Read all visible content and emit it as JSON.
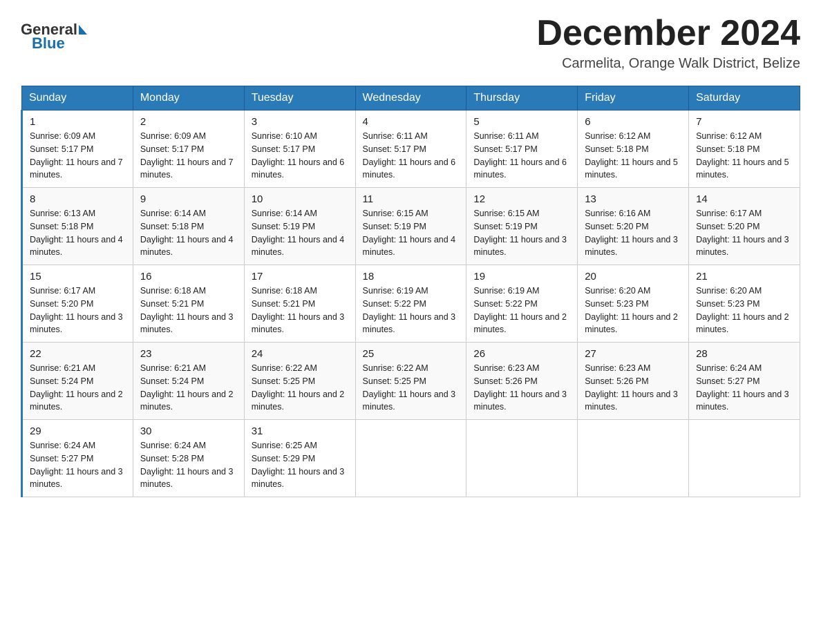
{
  "logo": {
    "general": "General",
    "blue": "Blue"
  },
  "title": "December 2024",
  "location": "Carmelita, Orange Walk District, Belize",
  "days_of_week": [
    "Sunday",
    "Monday",
    "Tuesday",
    "Wednesday",
    "Thursday",
    "Friday",
    "Saturday"
  ],
  "weeks": [
    [
      {
        "day": "1",
        "sunrise": "6:09 AM",
        "sunset": "5:17 PM",
        "daylight": "11 hours and 7 minutes."
      },
      {
        "day": "2",
        "sunrise": "6:09 AM",
        "sunset": "5:17 PM",
        "daylight": "11 hours and 7 minutes."
      },
      {
        "day": "3",
        "sunrise": "6:10 AM",
        "sunset": "5:17 PM",
        "daylight": "11 hours and 6 minutes."
      },
      {
        "day": "4",
        "sunrise": "6:11 AM",
        "sunset": "5:17 PM",
        "daylight": "11 hours and 6 minutes."
      },
      {
        "day": "5",
        "sunrise": "6:11 AM",
        "sunset": "5:17 PM",
        "daylight": "11 hours and 6 minutes."
      },
      {
        "day": "6",
        "sunrise": "6:12 AM",
        "sunset": "5:18 PM",
        "daylight": "11 hours and 5 minutes."
      },
      {
        "day": "7",
        "sunrise": "6:12 AM",
        "sunset": "5:18 PM",
        "daylight": "11 hours and 5 minutes."
      }
    ],
    [
      {
        "day": "8",
        "sunrise": "6:13 AM",
        "sunset": "5:18 PM",
        "daylight": "11 hours and 4 minutes."
      },
      {
        "day": "9",
        "sunrise": "6:14 AM",
        "sunset": "5:18 PM",
        "daylight": "11 hours and 4 minutes."
      },
      {
        "day": "10",
        "sunrise": "6:14 AM",
        "sunset": "5:19 PM",
        "daylight": "11 hours and 4 minutes."
      },
      {
        "day": "11",
        "sunrise": "6:15 AM",
        "sunset": "5:19 PM",
        "daylight": "11 hours and 4 minutes."
      },
      {
        "day": "12",
        "sunrise": "6:15 AM",
        "sunset": "5:19 PM",
        "daylight": "11 hours and 3 minutes."
      },
      {
        "day": "13",
        "sunrise": "6:16 AM",
        "sunset": "5:20 PM",
        "daylight": "11 hours and 3 minutes."
      },
      {
        "day": "14",
        "sunrise": "6:17 AM",
        "sunset": "5:20 PM",
        "daylight": "11 hours and 3 minutes."
      }
    ],
    [
      {
        "day": "15",
        "sunrise": "6:17 AM",
        "sunset": "5:20 PM",
        "daylight": "11 hours and 3 minutes."
      },
      {
        "day": "16",
        "sunrise": "6:18 AM",
        "sunset": "5:21 PM",
        "daylight": "11 hours and 3 minutes."
      },
      {
        "day": "17",
        "sunrise": "6:18 AM",
        "sunset": "5:21 PM",
        "daylight": "11 hours and 3 minutes."
      },
      {
        "day": "18",
        "sunrise": "6:19 AM",
        "sunset": "5:22 PM",
        "daylight": "11 hours and 3 minutes."
      },
      {
        "day": "19",
        "sunrise": "6:19 AM",
        "sunset": "5:22 PM",
        "daylight": "11 hours and 2 minutes."
      },
      {
        "day": "20",
        "sunrise": "6:20 AM",
        "sunset": "5:23 PM",
        "daylight": "11 hours and 2 minutes."
      },
      {
        "day": "21",
        "sunrise": "6:20 AM",
        "sunset": "5:23 PM",
        "daylight": "11 hours and 2 minutes."
      }
    ],
    [
      {
        "day": "22",
        "sunrise": "6:21 AM",
        "sunset": "5:24 PM",
        "daylight": "11 hours and 2 minutes."
      },
      {
        "day": "23",
        "sunrise": "6:21 AM",
        "sunset": "5:24 PM",
        "daylight": "11 hours and 2 minutes."
      },
      {
        "day": "24",
        "sunrise": "6:22 AM",
        "sunset": "5:25 PM",
        "daylight": "11 hours and 2 minutes."
      },
      {
        "day": "25",
        "sunrise": "6:22 AM",
        "sunset": "5:25 PM",
        "daylight": "11 hours and 3 minutes."
      },
      {
        "day": "26",
        "sunrise": "6:23 AM",
        "sunset": "5:26 PM",
        "daylight": "11 hours and 3 minutes."
      },
      {
        "day": "27",
        "sunrise": "6:23 AM",
        "sunset": "5:26 PM",
        "daylight": "11 hours and 3 minutes."
      },
      {
        "day": "28",
        "sunrise": "6:24 AM",
        "sunset": "5:27 PM",
        "daylight": "11 hours and 3 minutes."
      }
    ],
    [
      {
        "day": "29",
        "sunrise": "6:24 AM",
        "sunset": "5:27 PM",
        "daylight": "11 hours and 3 minutes."
      },
      {
        "day": "30",
        "sunrise": "6:24 AM",
        "sunset": "5:28 PM",
        "daylight": "11 hours and 3 minutes."
      },
      {
        "day": "31",
        "sunrise": "6:25 AM",
        "sunset": "5:29 PM",
        "daylight": "11 hours and 3 minutes."
      },
      null,
      null,
      null,
      null
    ]
  ]
}
